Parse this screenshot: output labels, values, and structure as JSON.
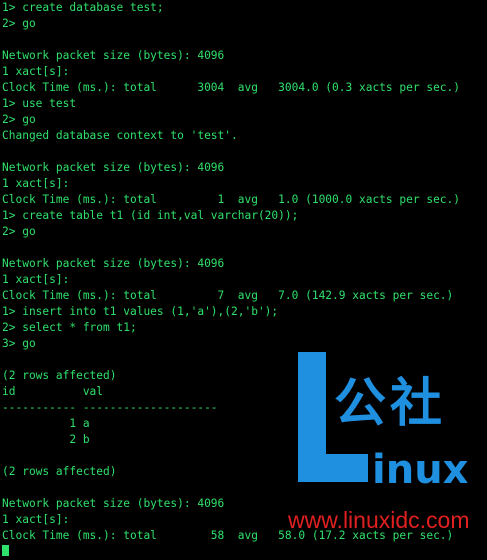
{
  "terminal": {
    "lines": [
      "1> create database test;",
      "2> go",
      "",
      "Network packet size (bytes): 4096",
      "1 xact[s]:",
      "Clock Time (ms.): total      3004  avg   3004.0 (0.3 xacts per sec.)",
      "1> use test",
      "2> go",
      "Changed database context to 'test'.",
      "",
      "Network packet size (bytes): 4096",
      "1 xact[s]:",
      "Clock Time (ms.): total         1  avg   1.0 (1000.0 xacts per sec.)",
      "1> create table t1 (id int,val varchar(20));",
      "2> go",
      "",
      "Network packet size (bytes): 4096",
      "1 xact[s]:",
      "Clock Time (ms.): total         7  avg   7.0 (142.9 xacts per sec.)",
      "1> insert into t1 values (1,'a'),(2,'b');",
      "2> select * from t1;",
      "3> go",
      "",
      "(2 rows affected)",
      "id          val",
      "----------- --------------------",
      "          1 a",
      "          2 b",
      "",
      "(2 rows affected)",
      "",
      "Network packet size (bytes): 4096",
      "1 xact[s]:",
      "Clock Time (ms.): total        58  avg   58.0 (17.2 xacts per sec.)",
      ""
    ]
  },
  "watermark": {
    "brand_cn": "公社",
    "brand_en": "inux",
    "url": "www.linuxidc.com",
    "color": "#1f8fe0",
    "url_color": "#e02020"
  },
  "colors": {
    "background": "#000000",
    "text": "#2fe06a"
  }
}
